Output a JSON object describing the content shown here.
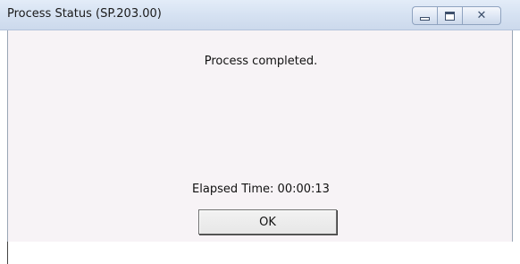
{
  "window": {
    "title": "Process Status (SP.203.00)",
    "controls": {
      "minimize_icon": "minimize-icon",
      "maximize_icon": "maximize-icon",
      "close_icon": "close-icon",
      "close_glyph": "✕"
    }
  },
  "dialog": {
    "message": "Process completed.",
    "elapsed_label": "Elapsed Time: 00:00:13",
    "ok_label": "OK"
  }
}
